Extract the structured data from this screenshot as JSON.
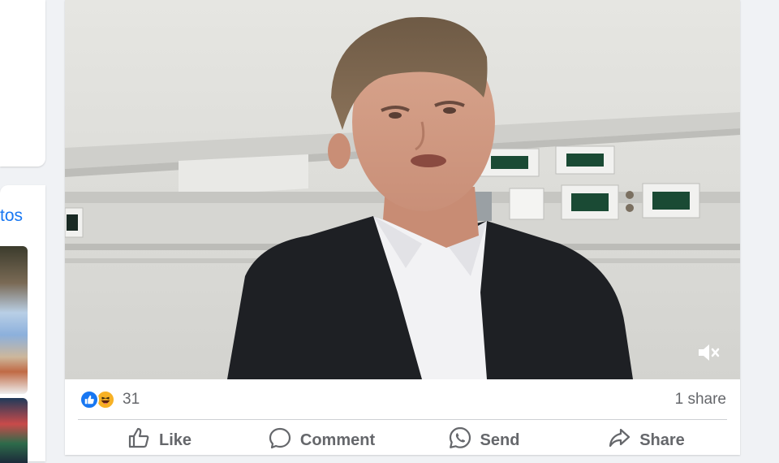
{
  "sidebar": {
    "link_fragment": "tos"
  },
  "post": {
    "video": {
      "mute_icon": "speaker-muted-icon"
    },
    "reactions": {
      "icons": [
        "like-reaction-icon",
        "haha-reaction-icon"
      ],
      "count": "31"
    },
    "shares": "1 share",
    "actions": {
      "like": "Like",
      "comment": "Comment",
      "send": "Send",
      "share": "Share"
    }
  },
  "colors": {
    "accent": "#1877f2",
    "muted_text": "#65676b",
    "background": "#f0f2f5",
    "haha_yellow": "#f7b125"
  }
}
